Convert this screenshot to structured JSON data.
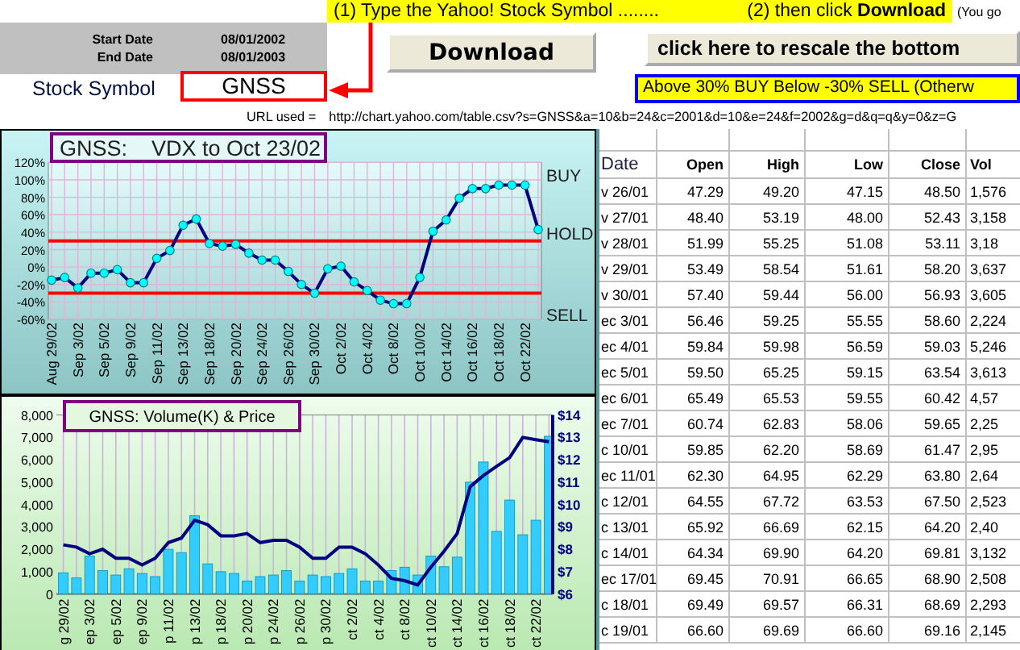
{
  "instructions": {
    "step1": "(1) Type the Yahoo! Stock Symbol ........",
    "step2": "(2) then click **Download**",
    "overflow": "(You go"
  },
  "date_range": [
    {
      "label": "Start Date",
      "value": "08/01/2002"
    },
    {
      "label": "End Date",
      "value": "08/01/2003"
    }
  ],
  "stock_symbol": {
    "label": "Stock Symbol",
    "value": "GNSS"
  },
  "buttons": [
    "Download",
    "click here to rescale the bottom"
  ],
  "signal_rule": "Above 30% BUY  Below -30% SELL (Otherw",
  "url": {
    "label": "URL used =",
    "value": "http://chart.yahoo.com/table.csv?s=GNSS&a=10&b=24&c=2001&d=10&e=24&f=2002&g=d&q=q&y=0&z=G"
  },
  "vdx_chart": {
    "chart_data": {
      "type": "line",
      "title": "GNSS:    VDX to Oct 23/02",
      "grid": true,
      "categories": [
        "Aug 29/02",
        null,
        "Sep 3/02",
        null,
        "Sep 5/02",
        null,
        "Sep 9/02",
        null,
        "Sep 11/02",
        null,
        "Sep 13/02",
        null,
        "Sep 18/02",
        null,
        "Sep 20/02",
        null,
        "Sep 24/02",
        null,
        "Sep 26/02",
        null,
        "Sep 30/02",
        null,
        "Oct 2/02",
        null,
        "Oct 4/02",
        null,
        "Oct 8/02",
        null,
        "Oct 10/02",
        null,
        "Oct 14/02",
        null,
        "Oct 16/02",
        null,
        "Oct 18/02",
        null,
        "Oct 22/02",
        null
      ],
      "series": [
        {
          "color": "#000080",
          "marker": "circle",
          "values": [
            -15,
            -12,
            -24,
            -7,
            -7,
            -3,
            -18,
            -18,
            10,
            19,
            48,
            55,
            27,
            24,
            26,
            16,
            8,
            8,
            -5,
            -20,
            -30,
            -2,
            1,
            -17,
            -27,
            -38,
            -42,
            -42,
            -12,
            41,
            54,
            79,
            90,
            90,
            94,
            94,
            94,
            43
          ]
        }
      ],
      "ylim": [
        -60,
        120
      ],
      "yticks": [
        {
          "value": -60,
          "label": "-60%"
        },
        {
          "value": -40,
          "label": "-40%"
        },
        {
          "value": -20,
          "label": "-20%"
        },
        {
          "value": 0,
          "label": "0%"
        },
        {
          "value": 20,
          "label": "20%"
        },
        {
          "value": 40,
          "label": "40%"
        },
        {
          "value": 60,
          "label": "60%"
        },
        {
          "value": 80,
          "label": "80%"
        },
        {
          "value": 100,
          "label": "100%"
        },
        {
          "value": 120,
          "label": "120%"
        }
      ],
      "ref_lines": [
        {
          "axis": "y",
          "value": 30,
          "color": "#ff0000"
        },
        {
          "axis": "y",
          "value": -30,
          "color": "#ff0000"
        }
      ],
      "annotations": [
        "BUY",
        "HOLD",
        "SELL"
      ]
    }
  },
  "volume_chart": {
    "chart_data": {
      "type": "bar",
      "title": "GNSS: Volume(K) & Price",
      "grid": true,
      "categories": [
        "g 29/02",
        null,
        "ep 3/02",
        null,
        "ep 5/02",
        null,
        "ep 9/02",
        null,
        "p 11/02",
        null,
        "p 13/02",
        null,
        "p 18/02",
        null,
        "p 20/02",
        null,
        "p 24/02",
        null,
        "p 26/02",
        null,
        "p 30/02",
        null,
        "ct 2/02",
        null,
        "ct 4/02",
        null,
        "ct 8/02",
        null,
        "ct 10/02",
        null,
        "ct 14/02",
        null,
        "ct 16/02",
        null,
        "ct 18/02",
        null,
        "ct 22/02",
        null
      ],
      "series": [
        {
          "type": "bar",
          "color": "#33ccff",
          "values": [
            950,
            720,
            1700,
            1050,
            850,
            1130,
            920,
            780,
            2000,
            1850,
            3500,
            1350,
            1000,
            920,
            580,
            780,
            850,
            1050,
            580,
            850,
            780,
            920,
            1130,
            580,
            580,
            1050,
            1200,
            850,
            1700,
            1220,
            1650,
            5000,
            5900,
            2800,
            4200,
            2650,
            3300,
            7050
          ]
        },
        {
          "type": "line",
          "axis": "y2",
          "color": "#000080",
          "values": [
            8.2,
            8.1,
            7.8,
            8.0,
            7.6,
            7.6,
            7.3,
            7.6,
            8.3,
            8.5,
            9.3,
            9.1,
            8.6,
            8.6,
            8.7,
            8.3,
            8.4,
            8.4,
            8.1,
            7.6,
            7.6,
            8.1,
            8.1,
            7.8,
            7.3,
            6.7,
            6.6,
            6.4,
            7.2,
            7.9,
            8.7,
            10.8,
            11.3,
            11.7,
            12.1,
            13.0,
            12.9,
            12.8
          ]
        }
      ],
      "ylim": [
        0,
        8000
      ],
      "yticks": [
        {
          "value": 0,
          "label": "0"
        },
        {
          "value": 1000,
          "label": "1,000"
        },
        {
          "value": 2000,
          "label": "2,000"
        },
        {
          "value": 3000,
          "label": "3,000"
        },
        {
          "value": 4000,
          "label": "4,000"
        },
        {
          "value": 5000,
          "label": "5,000"
        },
        {
          "value": 6000,
          "label": "6,000"
        },
        {
          "value": 7000,
          "label": "7,000"
        },
        {
          "value": 8000,
          "label": "8,000"
        }
      ],
      "y2lim": [
        6,
        14
      ],
      "y2ticks": [
        {
          "value": 6,
          "label": "$6"
        },
        {
          "value": 7,
          "label": "$7"
        },
        {
          "value": 8,
          "label": "$8"
        },
        {
          "value": 9,
          "label": "$9"
        },
        {
          "value": 10,
          "label": "$10"
        },
        {
          "value": 11,
          "label": "$11"
        },
        {
          "value": 12,
          "label": "$12"
        },
        {
          "value": 13,
          "label": "$13"
        },
        {
          "value": 14,
          "label": "$14"
        }
      ]
    }
  },
  "table": {
    "columns": [
      "Date",
      "Open",
      "High",
      "Low",
      "Close",
      "Vol"
    ],
    "rows": [
      [
        "v 26/01",
        "47.29",
        "49.20",
        "47.15",
        "48.50",
        "1,576"
      ],
      [
        "v 27/01",
        "48.40",
        "53.19",
        "48.00",
        "52.43",
        "3,158"
      ],
      [
        "v 28/01",
        "51.99",
        "55.25",
        "51.08",
        "53.11",
        "3,18"
      ],
      [
        "v 29/01",
        "53.49",
        "58.54",
        "51.61",
        "58.20",
        "3,637"
      ],
      [
        "v 30/01",
        "57.40",
        "59.44",
        "56.00",
        "56.93",
        "3,605"
      ],
      [
        "ec 3/01",
        "56.46",
        "59.25",
        "55.55",
        "58.60",
        "2,224"
      ],
      [
        "ec 4/01",
        "59.84",
        "59.98",
        "56.59",
        "59.03",
        "5,246"
      ],
      [
        "ec 5/01",
        "59.50",
        "65.25",
        "59.15",
        "63.54",
        "3,613"
      ],
      [
        "ec 6/01",
        "65.49",
        "65.53",
        "59.55",
        "60.42",
        "4,57"
      ],
      [
        "ec 7/01",
        "60.74",
        "62.83",
        "58.06",
        "59.65",
        "2,25"
      ],
      [
        "c 10/01",
        "59.85",
        "62.20",
        "58.69",
        "61.47",
        "2,95"
      ],
      [
        "ec 11/01",
        "62.30",
        "64.95",
        "62.29",
        "63.80",
        "2,64"
      ],
      [
        "c 12/01",
        "64.55",
        "67.72",
        "63.53",
        "67.50",
        "2,523"
      ],
      [
        "c 13/01",
        "65.92",
        "66.69",
        "62.15",
        "64.20",
        "2,40"
      ],
      [
        "c 14/01",
        "64.34",
        "69.90",
        "64.20",
        "69.81",
        "3,132"
      ],
      [
        "ec 17/01",
        "69.45",
        "70.91",
        "66.65",
        "68.90",
        "2,508"
      ],
      [
        "c 18/01",
        "69.49",
        "69.57",
        "66.31",
        "68.69",
        "2,293"
      ],
      [
        "c 19/01",
        "66.60",
        "69.69",
        "66.60",
        "69.16",
        "2,145"
      ]
    ]
  }
}
